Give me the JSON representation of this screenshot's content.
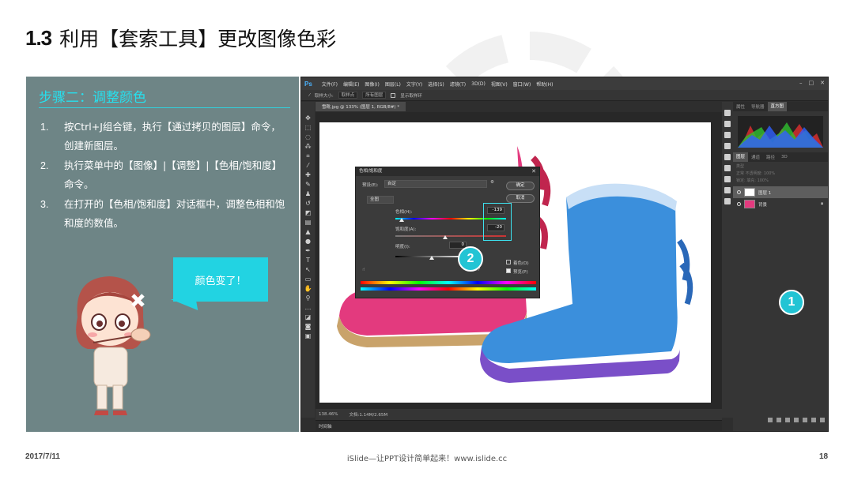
{
  "slide": {
    "number": "1.3",
    "title": "利用【套索工具】更改图像色彩",
    "footer_date": "2017/7/11",
    "footer_center": "iSlide—让PPT设计简单起来！www.islide.cc",
    "page_number": "18"
  },
  "left_panel": {
    "step_title": "步骤二：调整颜色",
    "steps": [
      {
        "num": "1.",
        "text": "按Ctrl+J组合键，执行【通过拷贝的图层】命令，创建新图层。"
      },
      {
        "num": "2.",
        "text": "执行菜单中的【图像】|【调整】|【色相/饱和度】命令。"
      },
      {
        "num": "3.",
        "text": "在打开的【色相/饱和度】对话框中，调整色相和饱和度的数值。"
      }
    ],
    "bubble_text": "颜色变了！"
  },
  "photoshop": {
    "logo": "Ps",
    "menu": [
      "文件(F)",
      "编辑(E)",
      "图像(I)",
      "图层(L)",
      "文字(Y)",
      "选择(S)",
      "滤镜(T)",
      "3D(D)",
      "视图(V)",
      "窗口(W)",
      "帮助(H)"
    ],
    "options": {
      "sample_label": "取样大小:",
      "sample_value": "取样点",
      "sample_all": "所有图层",
      "show_ring": "显示取样环"
    },
    "doc_tab": "雪靴.jpg @ 133% (图层 1, RGB/8#) *",
    "status_zoom": "138.46%",
    "status_doc": "文档:1.14M/2.65M",
    "timeline": "时间轴",
    "right_tabs_top": [
      "属性",
      "导航器",
      "直方图"
    ],
    "right_tabs_layers": [
      "图层",
      "通道",
      "路径",
      "3D"
    ],
    "layer_kind": "类型",
    "blend_mode": "正常",
    "opacity_label": "不透明度:",
    "opacity": "100%",
    "lock_label": "锁定:",
    "fill_label": "填充:",
    "fill": "100%",
    "layers": [
      {
        "name": "图层 1",
        "selected": true
      },
      {
        "name": "背景",
        "selected": false
      }
    ]
  },
  "dialog": {
    "title": "色相/饱和度",
    "preset_label": "预设(E):",
    "preset_value": "自定",
    "ok": "确定",
    "cancel": "取消",
    "channel": "全图",
    "hue_label": "色相(H):",
    "hue": "-139",
    "sat_label": "饱和度(A):",
    "sat": "-20",
    "light_label": "明度(I):",
    "light": "0",
    "colorize": "着色(O)",
    "preview": "预览(P)"
  },
  "badges": [
    "1",
    "2"
  ],
  "colors": {
    "panel_bg": "#6e8586",
    "accent": "#22d3e2",
    "pink_boot": "#e33a7e",
    "blue_boot": "#3b8fdc"
  }
}
